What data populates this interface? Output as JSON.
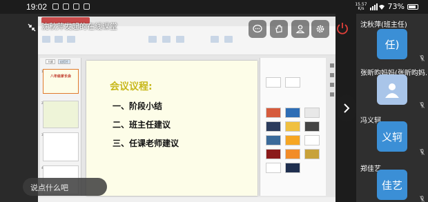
{
  "status": {
    "time": "19:02",
    "net_speed": "15.57",
    "net_unit": "K/s",
    "battery": "73%"
  },
  "meeting": {
    "topic": "沈秋萍发起的在线课堂",
    "chat_placeholder": "说点什么吧"
  },
  "slide": {
    "title": "会议议程:",
    "items": [
      "一、阶段小结",
      "二、班主任建议",
      "三、任课老师建议"
    ]
  },
  "thumbnails": {
    "tabs": [
      "大纲",
      "幻灯片"
    ],
    "first_title": "八年级家长会",
    "numbers": [
      "1",
      "2",
      "3",
      "4"
    ]
  },
  "participants": [
    {
      "name": "沈秋萍(班主任)",
      "avatar": "任)",
      "avatar_color": "#3b8fd6"
    },
    {
      "name": "张昕昀妈妈(张昕昀妈...",
      "avatar": "",
      "avatar_color": "#a9c5e9"
    },
    {
      "name": "冯义轲",
      "avatar": "义轲",
      "avatar_color": "#3b8fd6"
    },
    {
      "name": "郑佳艺",
      "avatar": "佳艺",
      "avatar_color": "#3b8fd6"
    }
  ],
  "icons": {
    "chat": "chat-bubble-icon",
    "hand": "raise-hand-icon",
    "member": "person-icon",
    "settings": "gear-icon",
    "leave": "power-icon",
    "next": "chevron-right-icon"
  },
  "colors": {
    "slide_title": "#c8b81d",
    "avatar_blue": "#3b8fd6",
    "leave_red": "#e0403a"
  }
}
